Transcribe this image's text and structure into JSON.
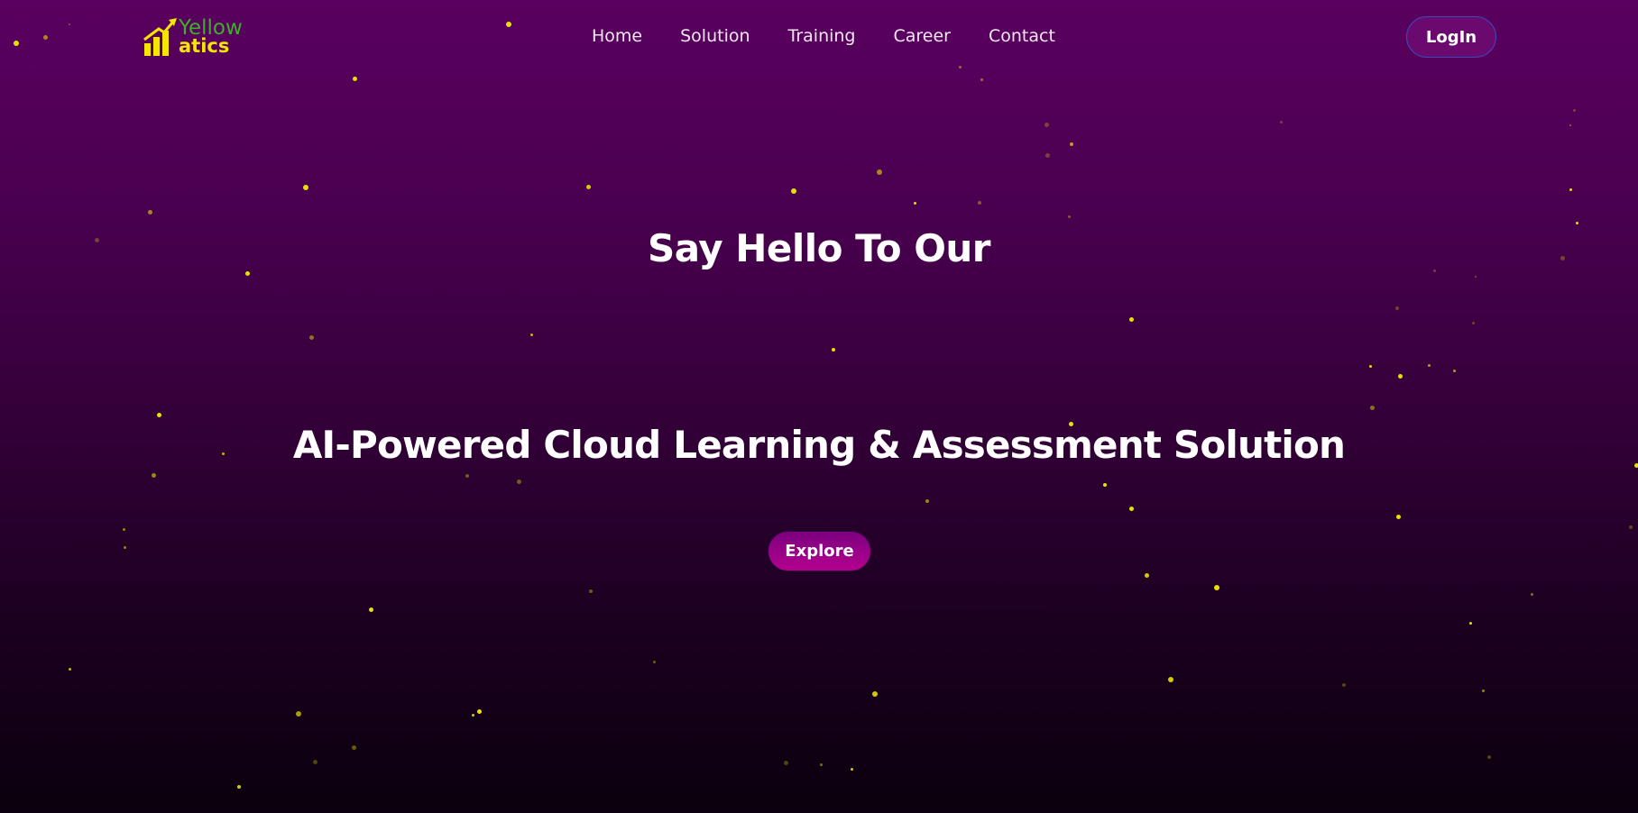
{
  "brand": {
    "logo_line1": "Yellow",
    "logo_line2": "atics",
    "color_green": "#3fae2a",
    "color_yellow": "#f5e600"
  },
  "nav": {
    "items": [
      {
        "label": "Home"
      },
      {
        "label": "Solution"
      },
      {
        "label": "Training"
      },
      {
        "label": "Career"
      },
      {
        "label": "Contact"
      }
    ],
    "login_label": "LogIn"
  },
  "hero": {
    "title": "Say Hello To Our",
    "subtitle": "AI-Powered Cloud Learning & Assessment Solution",
    "cta_label": "Explore"
  },
  "theme": {
    "background_top": "#5a0060",
    "background_bottom": "#0a000d",
    "star_color": "#e8e000",
    "button_accent": "#b4008f"
  }
}
